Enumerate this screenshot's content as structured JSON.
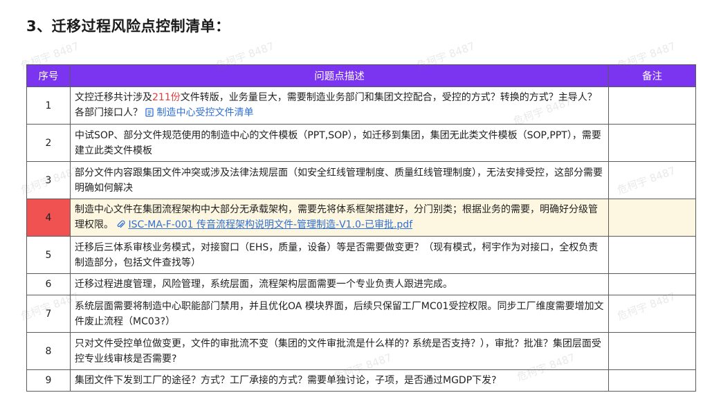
{
  "title": "3、迁移过程风险点控制清单：",
  "watermark": "危柯宇 8487",
  "table": {
    "headers": [
      "序号",
      "问题点描述",
      "备注"
    ],
    "rows": [
      {
        "no": "1",
        "pre": "文控迁移共计涉及",
        "red": "211份",
        "post": "文件转版，业务量巨大，需要制造业务部门和集团文控配合，受控的方式？转换的方式？主导人？各部门接口人？",
        "link": "制造中心受控文件清单",
        "note": ""
      },
      {
        "no": "2",
        "text": "中试SOP、部分文件规范使用的制造中心的文件模板（PPT,SOP），如迁移到集团，集团无此类文件模板（SOP,PPT），需要建立此类文件模板",
        "note": ""
      },
      {
        "no": "3",
        "text": "部分文件内容跟集团文件冲突或涉及法律法规层面（如安全红线管理制度、质量红线管理制度），无法安排受控，这部分需要明确如何解决",
        "note": ""
      },
      {
        "no": "4",
        "text": "制造中心文件在集团流程架构中大部分无承载架构，需要先将体系框架搭建好，分门别类；根据业务的需要，明确好分级管理权限。",
        "link": "ISC-MA-F-001 传音流程架构说明文件-管理制造-V1.0-已审批.pdf",
        "note": ""
      },
      {
        "no": "5",
        "text": "迁移后三体系审核业务模式，对接窗口（EHS，质量，设备）等是否需要做变更？（现有模式，柯宇作为对接口，全权负责制造部分，包括文件查找等）",
        "note": ""
      },
      {
        "no": "6",
        "text": "迁移过程进度管理，风险管理，系统层面，流程架构层面需要一个专业负责人跟进完成。",
        "note": ""
      },
      {
        "no": "7",
        "text": "系统层面需要将制造中心职能部门禁用，并且优化OA 模块界面，后续只保留工厂MC01受控权限。同步工厂维度需要增加文件废止流程（MC03?）",
        "note": ""
      },
      {
        "no": "8",
        "text": "只对文件受控单位做变更，文件的审批流不变（集团的文件审批流是什么样的? 系统是否支持？），审批？批准？集团层面受控专业线审核是否需要?",
        "note": ""
      },
      {
        "no": "9",
        "text": "集团文件下发到工厂的途径？方式？工厂承接的方式？需要单独讨论，子项，是否通过MGDP下发?",
        "note": ""
      }
    ]
  },
  "colors": {
    "header_bg": "#7b35f0",
    "highlight_num": "#f05252",
    "highlight_row": "#fdf7e2",
    "link": "#2f6fd6",
    "red_text": "#e03c3c"
  },
  "icons": {
    "row1_link": "document-icon",
    "row4_link": "paperclip-icon"
  }
}
